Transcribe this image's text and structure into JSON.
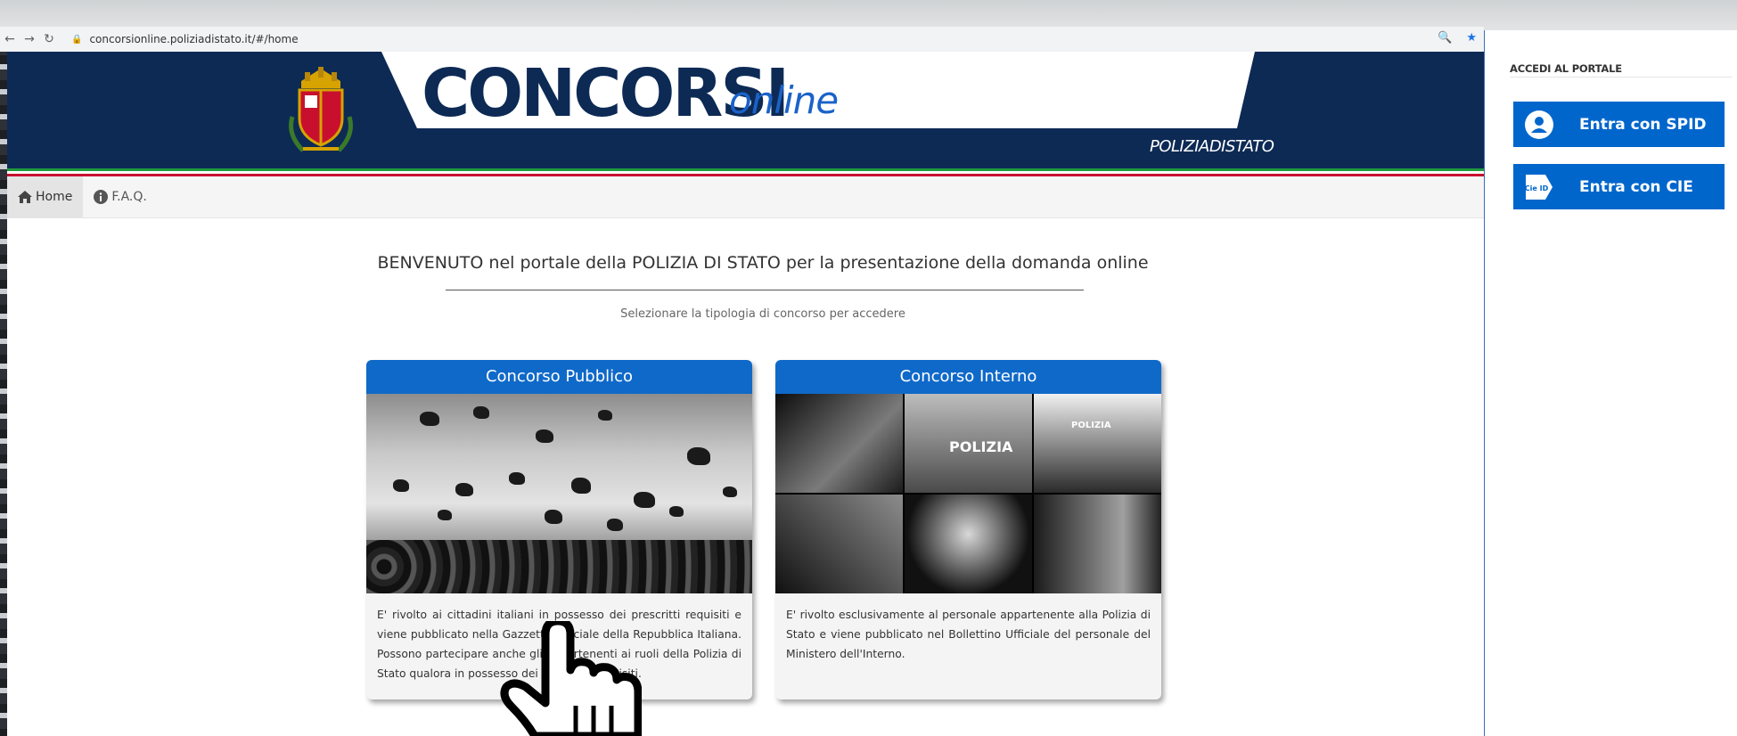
{
  "browser": {
    "url": "concorsionline.poliziadistato.it/#/home"
  },
  "header": {
    "brand_main": "CONCORSI",
    "brand_online": "online",
    "brand_sub": "POLIZIADISTATO"
  },
  "menu": {
    "items": [
      {
        "label": "Home",
        "icon": "home-icon"
      },
      {
        "label": "F.A.Q.",
        "icon": "info-icon"
      }
    ]
  },
  "main": {
    "welcome": "BENVENUTO nel portale della POLIZIA DI STATO per la presentazione della domanda online",
    "select_hint": "Selezionare la tipologia di concorso per accedere",
    "cards": [
      {
        "title": "Concorso Pubblico",
        "text": "E' rivolto ai cittadini italiani in possesso dei prescritti requisiti e viene pubblicato nella Gazzetta Ufficiale della Repubblica Italiana. Possono partecipare anche gli appartenenti ai ruoli della Polizia di Stato qualora in possesso dei prescritti requisiti."
      },
      {
        "title": "Concorso Interno",
        "text": "E' rivolto esclusivamente al personale appartenente alla Polizia di Stato e viene pubblicato nel Bollettino Ufficiale del personale del Ministero dell'Interno.",
        "image_label_1": "POLIZIA",
        "image_label_2": "POLIZIA"
      }
    ]
  },
  "sidebar": {
    "title": "ACCEDI AL PORTALE",
    "spid_label": "Entra con SPID",
    "cie_label": "Entra con CIE",
    "cie_icon_text": "Cie ID"
  },
  "colors": {
    "navy": "#0d2a55",
    "blue": "#0f69c9",
    "login_blue": "#0066cc"
  }
}
